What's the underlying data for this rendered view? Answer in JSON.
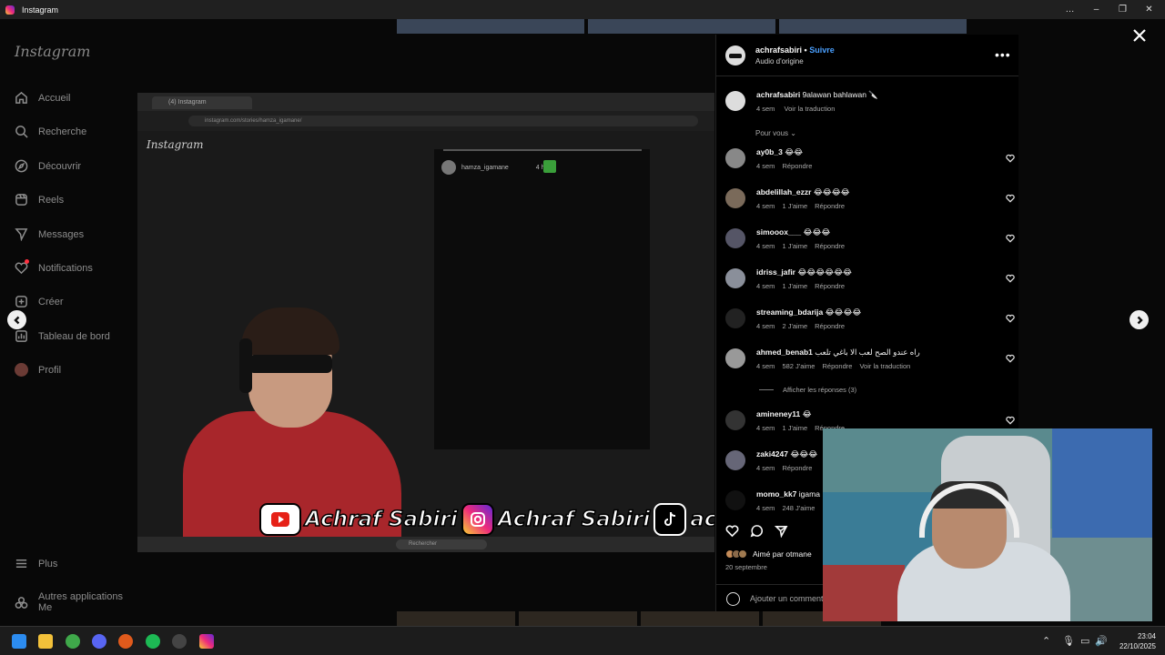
{
  "window": {
    "title": "Instagram",
    "controls": [
      "…",
      "–",
      "❐",
      "✕"
    ]
  },
  "sidebar": {
    "logo": "Instagram",
    "items": [
      {
        "label": "Accueil",
        "icon": "home-icon"
      },
      {
        "label": "Recherche",
        "icon": "search-icon"
      },
      {
        "label": "Découvrir",
        "icon": "compass-icon"
      },
      {
        "label": "Reels",
        "icon": "reels-icon"
      },
      {
        "label": "Messages",
        "icon": "messenger-icon"
      },
      {
        "label": "Notifications",
        "icon": "heart-icon"
      },
      {
        "label": "Créer",
        "icon": "plus-square-icon"
      },
      {
        "label": "Tableau de bord",
        "icon": "chart-icon"
      },
      {
        "label": "Profil",
        "icon": "avatar"
      }
    ],
    "bottom": [
      {
        "label": "Plus",
        "icon": "menu-icon"
      },
      {
        "label": "Autres applications Me",
        "icon": "apps-icon"
      }
    ]
  },
  "video": {
    "browser_tab": "(4) Instagram",
    "url": "instagram.com/stories/hamza_igamane/",
    "inner_logo": "Instagram",
    "story_user": "hamza_igamane",
    "story_time": "4 h",
    "banner": {
      "yt": "Achraf Sabiri",
      "ig": "Achraf Sabiri",
      "tt": "achra"
    },
    "taskbar_search": "Rechercher"
  },
  "post": {
    "author": "achrafsabiri",
    "follow_label": "Suivre",
    "audio": "Audio d'origine",
    "caption": {
      "user": "achrafsabiri",
      "text": "9alawan bahlawan 🔪",
      "time": "4 sem",
      "translate": "Voir la traduction"
    },
    "filter": "Pour vous",
    "comments": [
      {
        "user": "ay0b_3",
        "text": "😂😂",
        "time": "4 sem",
        "likes": "",
        "reply": "Répondre",
        "avatar": "#888"
      },
      {
        "user": "abdelillah_ezzr",
        "text": "😂😂😂😂",
        "time": "4 sem",
        "likes": "1 J'aime",
        "reply": "Répondre",
        "avatar": "#7a6a5a"
      },
      {
        "user": "simooox___",
        "text": "😂😂😂",
        "time": "4 sem",
        "likes": "1 J'aime",
        "reply": "Répondre",
        "avatar": "#556"
      },
      {
        "user": "idriss_jafir",
        "text": "😂😂😂😂😂😂",
        "time": "4 sem",
        "likes": "1 J'aime",
        "reply": "Répondre",
        "avatar": "#8a8f9a"
      },
      {
        "user": "streaming_bdarija",
        "text": "😂😂😂😂",
        "time": "4 sem",
        "likes": "2 J'aime",
        "reply": "Répondre",
        "avatar": "#222"
      },
      {
        "user": "ahmed_benab1",
        "text": "راه عندو الصح لعب الا باغي تلعب",
        "time": "4 sem",
        "likes": "582 J'aime",
        "reply": "Répondre",
        "translate": "Voir la traduction",
        "avatar": "#999"
      },
      {
        "user": "amineney11",
        "text": "😂",
        "time": "4 sem",
        "likes": "1 J'aime",
        "reply": "Répondre",
        "avatar": "#333"
      },
      {
        "user": "zaki4247",
        "text": "😂😂😂",
        "time": "4 sem",
        "likes": "",
        "reply": "Répondre",
        "avatar": "#667"
      },
      {
        "user": "momo_kk7",
        "text": "igama",
        "time": "4 sem",
        "likes": "248 J'aime",
        "reply": "",
        "avatar": "#111"
      }
    ],
    "replies_label": "Afficher les réponses (3)",
    "liked_by": "Aimé par otmane",
    "date": "20 septembre",
    "add_comment_placeholder": "Ajouter un commentaire…"
  },
  "taskbar": {
    "time": "23:04",
    "date": "22/10/2025"
  },
  "colors": {
    "link": "#4aa0ff",
    "panel_bg": "#000000",
    "overlay": "#080808",
    "shirt": "#a8262b"
  }
}
